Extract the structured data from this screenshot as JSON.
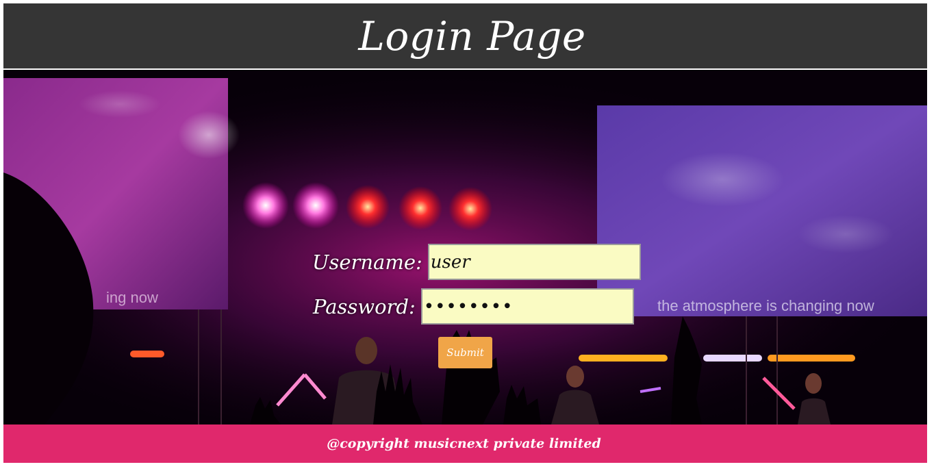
{
  "header": {
    "title": "Login Page"
  },
  "hero": {
    "screen_left_text": "ing now",
    "screen_right_text": "the atmosphere is changing now"
  },
  "form": {
    "username_label": "Username:",
    "username_value": "user",
    "password_label": "Password:",
    "password_value": "••••••••",
    "submit_label": "Submit"
  },
  "footer": {
    "copyright": "@copyright musicnext private limited"
  },
  "colors": {
    "header_bg": "#353535",
    "footer_bg": "#e0286c",
    "input_bg": "#fafbc3",
    "button_bg": "#f0a548"
  }
}
